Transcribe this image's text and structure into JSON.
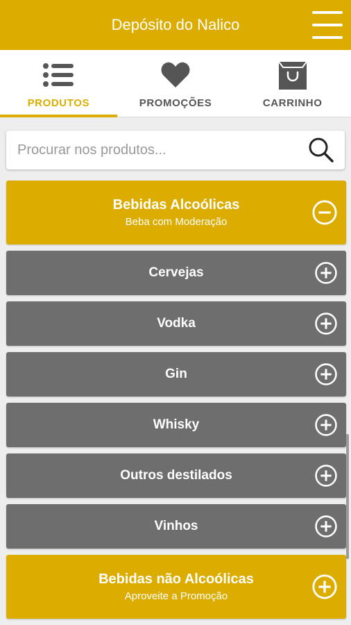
{
  "header": {
    "title": "Depósito do Nalico",
    "menu_icon": "hamburger-menu-icon"
  },
  "tabs": [
    {
      "label": "PRODUTOS",
      "icon": "list-icon",
      "active": true
    },
    {
      "label": "PROMOÇÕES",
      "icon": "heart-icon",
      "active": false
    },
    {
      "label": "CARRINHO",
      "icon": "shopping-bag-icon",
      "active": false
    }
  ],
  "search": {
    "placeholder": "Procurar nos produtos...",
    "value": "",
    "icon": "search-icon"
  },
  "categories": [
    {
      "title": "Bebidas Alcoólicas",
      "subtitle": "Beba com Moderação",
      "expanded": true,
      "icon": "minus-circle-icon",
      "subcategories": [
        {
          "title": "Cervejas",
          "icon": "plus-circle-icon"
        },
        {
          "title": "Vodka",
          "icon": "plus-circle-icon"
        },
        {
          "title": "Gin",
          "icon": "plus-circle-icon"
        },
        {
          "title": "Whisky",
          "icon": "plus-circle-icon"
        },
        {
          "title": "Outros destilados",
          "icon": "plus-circle-icon"
        },
        {
          "title": "Vinhos",
          "icon": "plus-circle-icon"
        }
      ]
    },
    {
      "title": "Bebidas não Alcoólicas",
      "subtitle": "Aproveite a Promoção",
      "expanded": false,
      "icon": "plus-circle-icon"
    }
  ],
  "colors": {
    "accent": "#dcad00",
    "subcategory_bg": "#6e6e6e",
    "tab_inactive": "#555555"
  }
}
